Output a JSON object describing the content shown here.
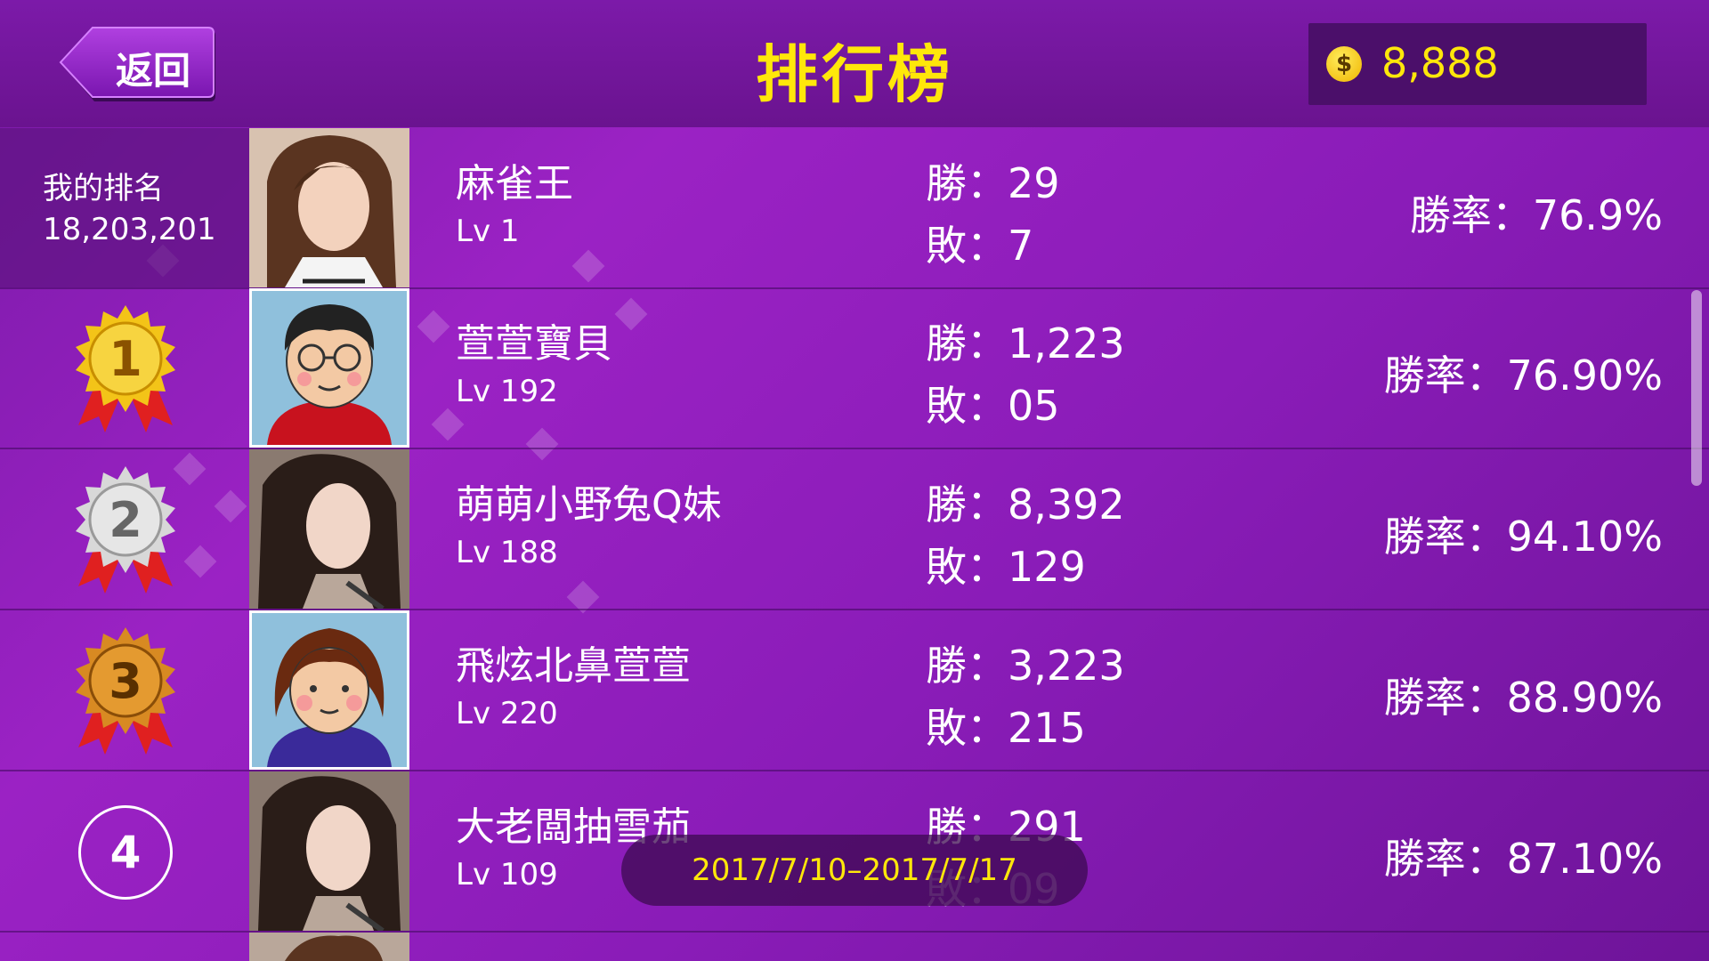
{
  "header": {
    "back_label": "返回",
    "title": "排行榜",
    "coins": "8,888",
    "coin_symbol": "$"
  },
  "me": {
    "label": "我的排名",
    "rank": "18,203,201",
    "name": "麻雀王",
    "level": "Lv 1",
    "win": "勝：29",
    "loss": "敗：7",
    "rate": "勝率：76.9%"
  },
  "rows": [
    {
      "rank": "1",
      "name": "萱萱寶貝",
      "level": "Lv 192",
      "win": "勝：1,223",
      "loss": "敗：05",
      "rate": "勝率：76.90%"
    },
    {
      "rank": "2",
      "name": "萌萌小野兔Q妹",
      "level": "Lv 188",
      "win": "勝：8,392",
      "loss": "敗：129",
      "rate": "勝率：94.10%"
    },
    {
      "rank": "3",
      "name": "飛炫北鼻萱萱",
      "level": "Lv 220",
      "win": "勝：3,223",
      "loss": "敗：215",
      "rate": "勝率：88.90%"
    },
    {
      "rank": "4",
      "name": "大老闆抽雪茄",
      "level": "Lv 109",
      "win": "勝：291",
      "loss": "敗：09",
      "rate": "勝率：87.10%"
    }
  ],
  "date_range": "2017/7/10–2017/7/17",
  "colors": {
    "accent": "#ffe70a",
    "gold": "#f0b400",
    "silver": "#c8c8c8",
    "bronze": "#c8761a"
  }
}
